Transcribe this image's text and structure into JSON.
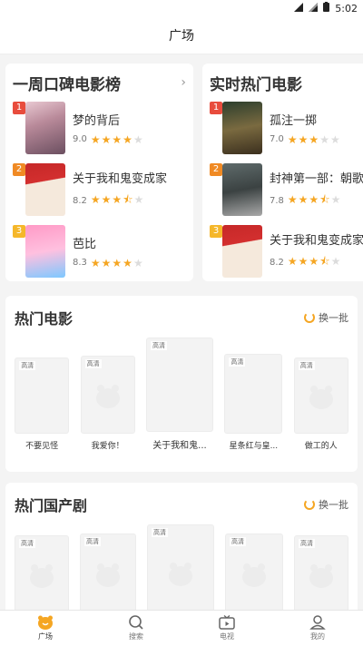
{
  "status_bar": {
    "time": "5:02"
  },
  "header": {
    "title": "广场"
  },
  "rank_lists": [
    {
      "title": "一周口碑电影榜",
      "arrow": "›",
      "items": [
        {
          "rank": "1",
          "name": "梦的背后",
          "score": "9.0",
          "stars": 4
        },
        {
          "rank": "2",
          "name": "关于我和鬼变成家",
          "score": "8.2",
          "stars": 3.5
        },
        {
          "rank": "3",
          "name": "芭比",
          "score": "8.3",
          "stars": 4
        }
      ]
    },
    {
      "title": "实时热门电影",
      "arrow": "",
      "items": [
        {
          "rank": "1",
          "name": "孤注一掷",
          "score": "7.0",
          "stars": 3
        },
        {
          "rank": "2",
          "name": "封神第一部：朝歌",
          "score": "7.8",
          "stars": 3.5
        },
        {
          "rank": "3",
          "name": "关于我和鬼变成家",
          "score": "8.2",
          "stars": 3.5
        }
      ]
    }
  ],
  "hot_movies": {
    "title": "热门电影",
    "refresh_label": "换一批",
    "hq_label": "高清",
    "items": [
      {
        "title": "不要见怪"
      },
      {
        "title": "我爱你！"
      },
      {
        "title": "关于我和鬼..."
      },
      {
        "title": "星条红与皇..."
      },
      {
        "title": "做工的人"
      }
    ]
  },
  "hot_dramas": {
    "title": "热门国产剧",
    "refresh_label": "换一批",
    "hq_label": "高清"
  },
  "tabbar": {
    "items": [
      {
        "label": "广场",
        "icon": "home-icon",
        "active": true
      },
      {
        "label": "搜索",
        "icon": "search-icon",
        "active": false
      },
      {
        "label": "电视",
        "icon": "tv-icon",
        "active": false
      },
      {
        "label": "我的",
        "icon": "profile-icon",
        "active": false
      }
    ]
  },
  "colors": {
    "accent": "#f5a623",
    "rank1": "#e84c3d",
    "rank2": "#f08a24",
    "rank3": "#f5b72a"
  }
}
